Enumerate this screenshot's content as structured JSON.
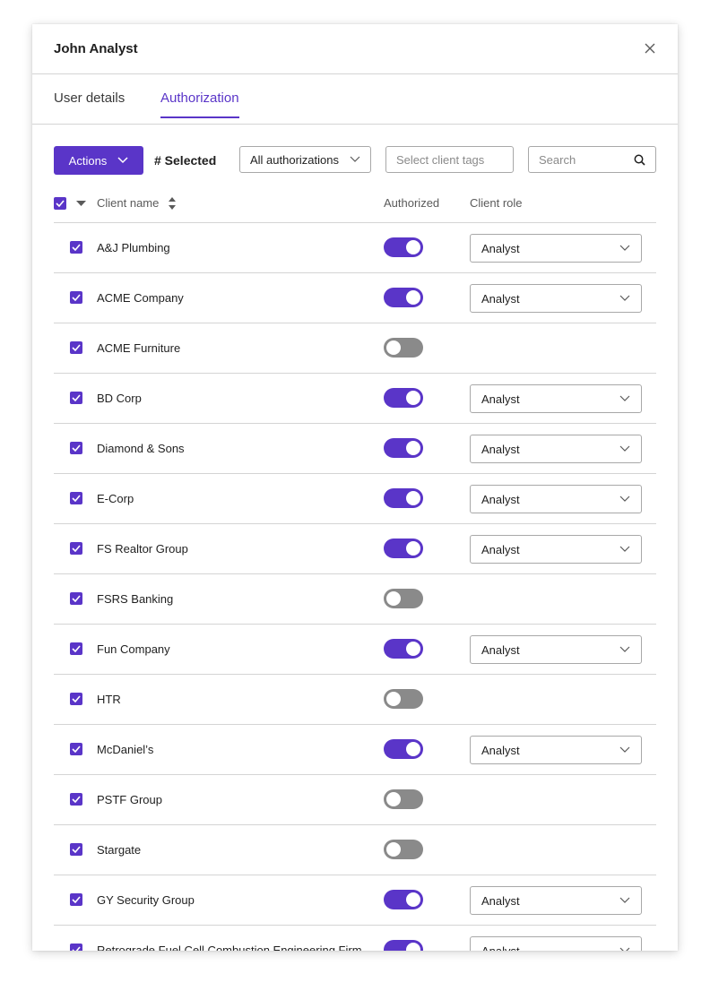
{
  "modal": {
    "title": "John Analyst"
  },
  "tabs": [
    {
      "label": "User details",
      "active": false
    },
    {
      "label": "Authorization",
      "active": true
    }
  ],
  "toolbar": {
    "actions_label": "Actions",
    "selected_label": "# Selected",
    "filter_value": "All authorizations",
    "tags_placeholder": "Select client tags",
    "search_placeholder": "Search"
  },
  "table": {
    "headers": {
      "client_name": "Client name",
      "authorized": "Authorized",
      "client_role": "Client role"
    },
    "rows": [
      {
        "name": "A&J Plumbing",
        "checked": true,
        "authorized": true,
        "role": "Analyst"
      },
      {
        "name": "ACME Company",
        "checked": true,
        "authorized": true,
        "role": "Analyst"
      },
      {
        "name": "ACME Furniture",
        "checked": true,
        "authorized": false,
        "role": ""
      },
      {
        "name": "BD Corp",
        "checked": true,
        "authorized": true,
        "role": "Analyst"
      },
      {
        "name": "Diamond & Sons",
        "checked": true,
        "authorized": true,
        "role": "Analyst"
      },
      {
        "name": "E-Corp",
        "checked": true,
        "authorized": true,
        "role": "Analyst"
      },
      {
        "name": "FS Realtor Group",
        "checked": true,
        "authorized": true,
        "role": "Analyst"
      },
      {
        "name": "FSRS Banking",
        "checked": true,
        "authorized": false,
        "role": ""
      },
      {
        "name": "Fun Company",
        "checked": true,
        "authorized": true,
        "role": "Analyst"
      },
      {
        "name": "HTR",
        "checked": true,
        "authorized": false,
        "role": ""
      },
      {
        "name": "McDaniel’s",
        "checked": true,
        "authorized": true,
        "role": "Analyst"
      },
      {
        "name": "PSTF Group",
        "checked": true,
        "authorized": false,
        "role": ""
      },
      {
        "name": "Stargate",
        "checked": true,
        "authorized": false,
        "role": ""
      },
      {
        "name": "GY Security Group",
        "checked": true,
        "authorized": true,
        "role": "Analyst"
      },
      {
        "name": "Retrograde Fuel Cell Combustion Engineering Firm",
        "checked": true,
        "authorized": true,
        "role": "Analyst"
      }
    ]
  },
  "colors": {
    "accent": "#5a35c8",
    "toggle_off": "#8a8a8a",
    "border": "#d4d4d4"
  }
}
